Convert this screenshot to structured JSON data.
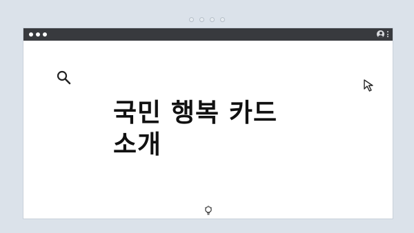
{
  "page": {
    "title_line1": "국민 행복 카드",
    "title_line2": "소개"
  },
  "icons": {
    "search": "search-icon",
    "cursor": "cursor-arrow-icon",
    "bulb": "lightbulb-icon",
    "profile": "profile-icon",
    "menu": "kebab-menu-icon"
  },
  "colors": {
    "background": "#dbe2ea",
    "titlebar": "#383a3e",
    "text": "#111111"
  }
}
